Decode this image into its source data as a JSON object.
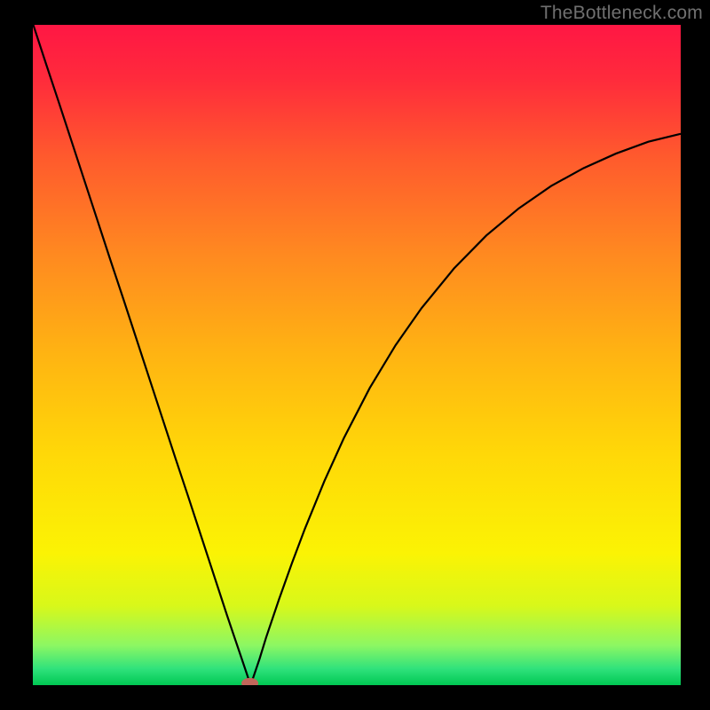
{
  "watermark": "TheBottleneck.com",
  "chart_data": {
    "type": "line",
    "title": "",
    "xlabel": "",
    "ylabel": "",
    "xlim": [
      0,
      100
    ],
    "ylim": [
      0,
      100
    ],
    "grid": false,
    "legend": false,
    "background_gradient": {
      "stops": [
        {
          "offset": 0.0,
          "color": "#ff1744"
        },
        {
          "offset": 0.08,
          "color": "#ff2a3c"
        },
        {
          "offset": 0.2,
          "color": "#ff5a2d"
        },
        {
          "offset": 0.35,
          "color": "#ff8a20"
        },
        {
          "offset": 0.5,
          "color": "#ffb412"
        },
        {
          "offset": 0.65,
          "color": "#ffd808"
        },
        {
          "offset": 0.8,
          "color": "#fbf304"
        },
        {
          "offset": 0.88,
          "color": "#d8f81a"
        },
        {
          "offset": 0.94,
          "color": "#8cf763"
        },
        {
          "offset": 0.975,
          "color": "#30e27c"
        },
        {
          "offset": 1.0,
          "color": "#00c853"
        }
      ]
    },
    "series": [
      {
        "name": "curve",
        "color": "#000000",
        "x": [
          0,
          2,
          4,
          6,
          8,
          10,
          12,
          14,
          16,
          18,
          20,
          22,
          24,
          26,
          28,
          30,
          31,
          32,
          33,
          33.5,
          34,
          35,
          36,
          38,
          40,
          42,
          45,
          48,
          52,
          56,
          60,
          65,
          70,
          75,
          80,
          85,
          90,
          95,
          100
        ],
        "y": [
          100.2,
          94.2,
          88.3,
          82.3,
          76.3,
          70.3,
          64.3,
          58.4,
          52.4,
          46.4,
          40.4,
          34.4,
          28.5,
          22.5,
          16.5,
          10.5,
          7.6,
          4.7,
          1.8,
          0.3,
          1.1,
          4.0,
          7.2,
          13.0,
          18.5,
          23.7,
          30.9,
          37.4,
          45.0,
          51.5,
          57.1,
          63.1,
          68.1,
          72.2,
          75.6,
          78.3,
          80.5,
          82.3,
          83.5
        ]
      }
    ],
    "marker": {
      "x": 33.5,
      "y": 0.3,
      "rx": 1.3,
      "ry": 0.8,
      "fill": "#c1665a"
    }
  }
}
